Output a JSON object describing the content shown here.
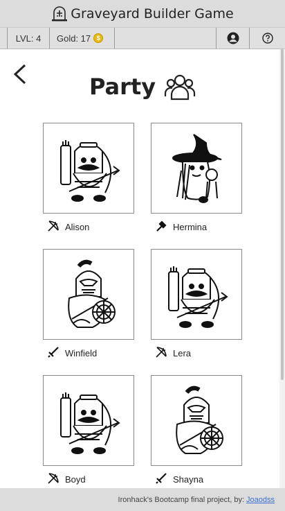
{
  "app": {
    "title": "Graveyard Builder Game"
  },
  "status": {
    "level": "LVL: 4",
    "gold": "Gold: 17"
  },
  "page": {
    "title": "Party"
  },
  "party": [
    {
      "name": "Alison",
      "class_icon": "bow-icon",
      "portrait": "ranger-portrait"
    },
    {
      "name": "Hermina",
      "class_icon": "staff-icon",
      "portrait": "wizard-portrait"
    },
    {
      "name": "Winfield",
      "class_icon": "sword-icon",
      "portrait": "knight-portrait"
    },
    {
      "name": "Lera",
      "class_icon": "bow-icon",
      "portrait": "ranger-portrait"
    },
    {
      "name": "Boyd",
      "class_icon": "bow-icon",
      "portrait": "ranger-portrait"
    },
    {
      "name": "Shayna",
      "class_icon": "sword-icon",
      "portrait": "knight-portrait"
    }
  ],
  "footer": {
    "text": "Ironhack's Bootcamp final project, by:",
    "link": "Joaodss"
  },
  "colors": {
    "coin": "#e8b90e",
    "link": "#3a6fd8",
    "bar": "#dcdcdc"
  }
}
